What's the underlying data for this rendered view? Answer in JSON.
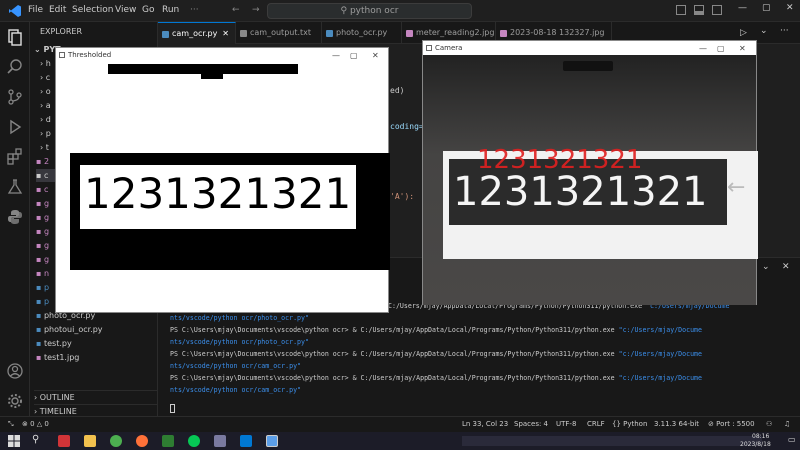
{
  "titlebar": {
    "menus": [
      "File",
      "Edit",
      "Selection",
      "View",
      "Go",
      "Run"
    ],
    "search": "python ocr"
  },
  "sidebar": {
    "header": "EXPLORER",
    "root": "PYT",
    "items": [
      "photo_ocr.py",
      "photoui_ocr.py",
      "test.py",
      "test1.jpg"
    ],
    "outline": "OUTLINE",
    "timeline": "TIMELINE"
  },
  "tabs": [
    {
      "label": "cam_ocr.py",
      "active": true,
      "color": "#4b8bbe"
    },
    {
      "label": "cam_output.txt",
      "active": false,
      "color": "#888888"
    },
    {
      "label": "photo_ocr.py",
      "active": false,
      "color": "#4b8bbe"
    },
    {
      "label": "meter_reading2.jpg",
      "active": false,
      "color": "#c586c0"
    },
    {
      "label": "2023-08-18 132327.jpg",
      "active": false,
      "color": "#c586c0"
    }
  ],
  "editor": {
    "fragment1": "ed)",
    "fragment2": "coding=",
    "fragment3": "'A'):"
  },
  "thresholded_window": {
    "title": "Thresholded",
    "digits": "1231321321"
  },
  "camera_window": {
    "title": "Camera",
    "overlay_text": "1231321321",
    "display_digits": "1231321321"
  },
  "terminal": {
    "lines": [
      {
        "text": "",
        "cont": "C:/Users/mjay/AppData/Local/Programs/Python/Python311/python.exe",
        "arg": "\"c:/Users/mjay/Docume"
      },
      {
        "text": "nts/vscode/python ocr/photo_ocr.py\"",
        "cont": "",
        "arg": ""
      },
      {
        "text": "PS C:\\Users\\mjay\\Documents\\vscode\\python ocr> & C:/Users/mjay/AppData/Local/Programs/Python/Python311/python.exe",
        "cont": "",
        "arg": "\"c:/Users/mjay/Docume"
      },
      {
        "text": "nts/vscode/python ocr/photo_ocr.py\"",
        "cont": "",
        "arg": ""
      },
      {
        "text": "PS C:\\Users\\mjay\\Documents\\vscode\\python ocr> & C:/Users/mjay/AppData/Local/Programs/Python/Python311/python.exe",
        "cont": "",
        "arg": "\"c:/Users/mjay/Docume"
      },
      {
        "text": "nts/vscode/python ocr/cam_ocr.py\"",
        "cont": "",
        "arg": ""
      },
      {
        "text": "PS C:\\Users\\mjay\\Documents\\vscode\\python ocr> & C:/Users/mjay/AppData/Local/Programs/Python/Python311/python.exe",
        "cont": "",
        "arg": "\"c:/Users/mjay/Docume"
      },
      {
        "text": "nts/vscode/python ocr/cam_ocr.py\"",
        "cont": "",
        "arg": ""
      }
    ]
  },
  "statusbar": {
    "errors": "0",
    "warnings": "0",
    "position": "Ln 33, Col 23",
    "spaces": "Spaces: 4",
    "encoding": "UTF-8",
    "eol": "CRLF",
    "language": "Python",
    "interpreter": "3.11.3 64-bit",
    "port": "Port : 5500"
  },
  "taskbar": {
    "time": "08:16",
    "date": "2023/8/18"
  },
  "colors": {
    "accent": "#0078d4",
    "terminal_arg": "#3b8eea",
    "overlay_red": "#e02020"
  }
}
